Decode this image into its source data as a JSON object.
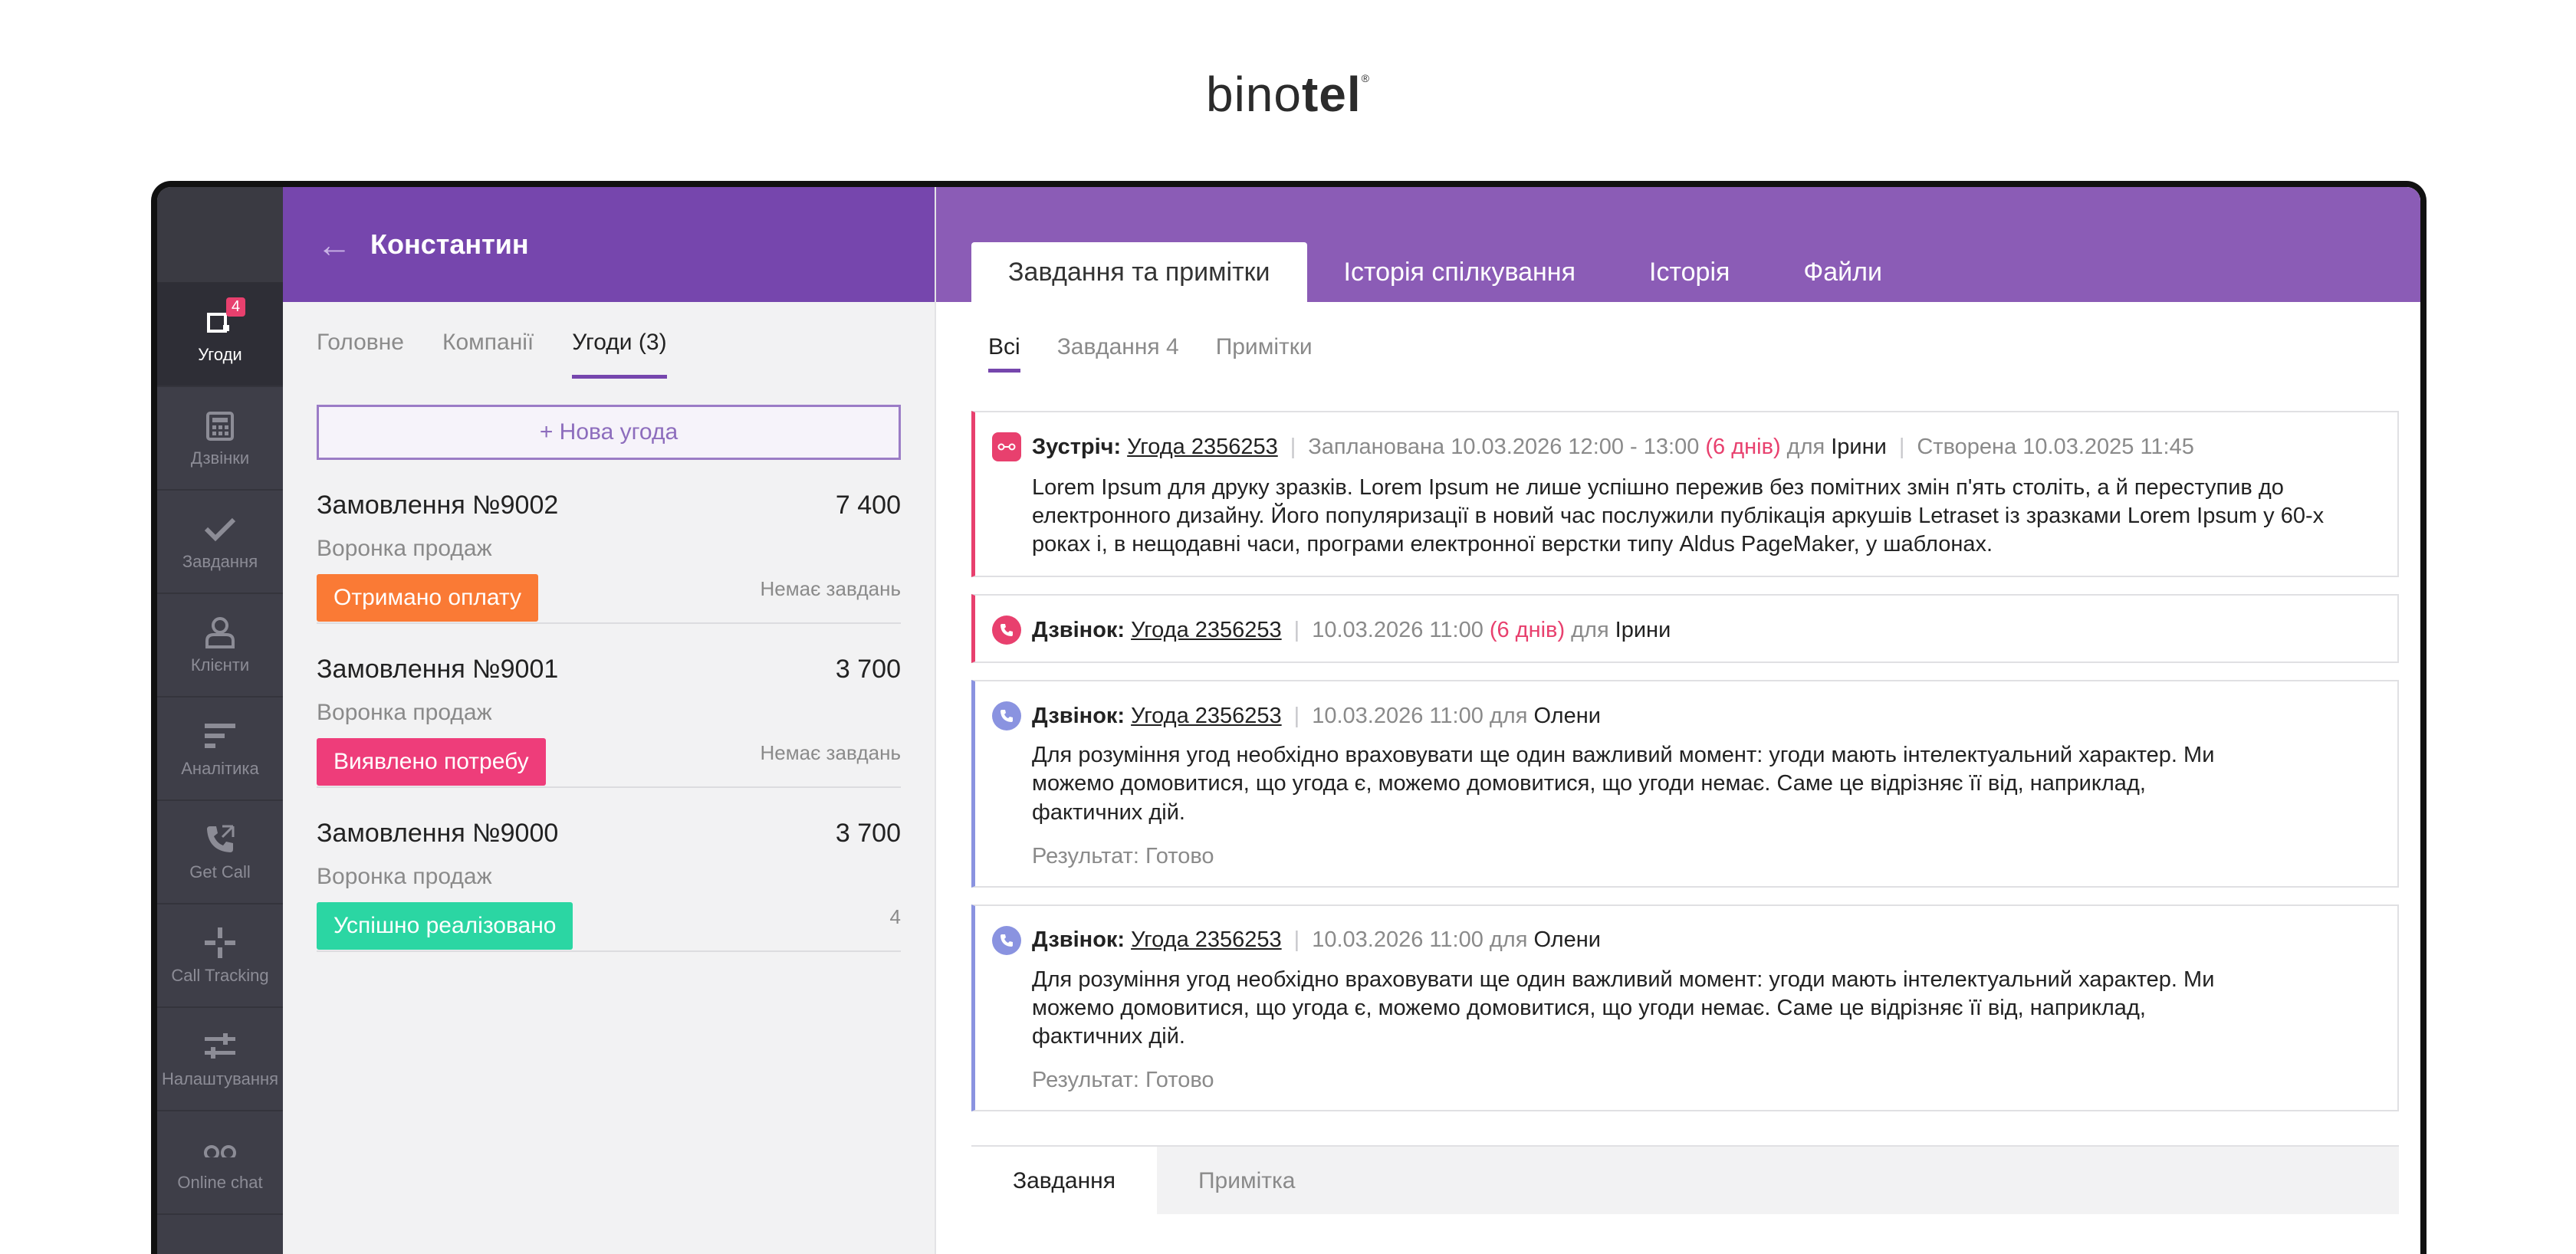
{
  "brand": {
    "pre": "bino",
    "bold": "tel",
    "mark": "®"
  },
  "sidebar": {
    "items": [
      {
        "label": "Угоди",
        "icon": "deals-icon",
        "badge": "4",
        "active": true
      },
      {
        "label": "Дзвінки",
        "icon": "phone-keypad-icon"
      },
      {
        "label": "Завдання",
        "icon": "checkmark-icon"
      },
      {
        "label": "Клієнти",
        "icon": "user-icon"
      },
      {
        "label": "Аналітика",
        "icon": "analytics-icon"
      },
      {
        "label": "Get Call",
        "icon": "callback-icon"
      },
      {
        "label": "Call Tracking",
        "icon": "crosshair-icon"
      },
      {
        "label": "Налаштування",
        "icon": "settings-sliders-icon"
      },
      {
        "label": "Online chat",
        "icon": "chat-icon"
      }
    ]
  },
  "contact": {
    "name": "Константин"
  },
  "left_tabs": [
    "Головне",
    "Компанії",
    "Угоди (3)"
  ],
  "new_deal": "+ Нова угода",
  "deals": [
    {
      "title": "Замовлення №9002",
      "amount": "7 400",
      "funnel": "Воронка продаж",
      "stage": "Отримано оплату",
      "stage_color": "#fa7a35",
      "note": "Немає завдань"
    },
    {
      "title": "Замовлення №9001",
      "amount": "3 700",
      "funnel": "Воронка продаж",
      "stage": "Виявлено потребу",
      "stage_color": "#ee3d7a",
      "note": "Немає завдань"
    },
    {
      "title": "Замовлення №9000",
      "amount": "3 700",
      "funnel": "Воронка продаж",
      "stage": "Успішно реалізовано",
      "stage_color": "#2bd6a3",
      "note": "4"
    }
  ],
  "right_tabs": [
    "Завдання та примітки",
    "Історія спілкування",
    "Історія",
    "Файли"
  ],
  "sub_tabs": [
    "Всі",
    "Завдання 4",
    "Примітки"
  ],
  "feed": [
    {
      "type": "Зустріч:",
      "deal": "Угода 2356253",
      "planned": "Запланована 10.03.2026 12:00 - 13:00",
      "days": "(6 днів)",
      "for": "для",
      "who": "Ірини",
      "created": "Створена 10.03.2025 11:45",
      "body": "Lorem Ipsum для друку зразків. Lorem Ipsum не лише успішно пережив без помітних змін п'ять століть, а й переступив до електронного дизайну. Його популяризації в новий час послужили публікація аркушів Letraset із зразками Lorem Ipsum у 60-х роках і, в нещодавні часи, програми електронної верстки типу Aldus PageMaker, у шаблонах."
    },
    {
      "type": "Дзвінок:",
      "deal": "Угода 2356253",
      "time": "10.03.2026 11:00",
      "days": "(6 днів)",
      "for": "для",
      "who": "Ірини"
    },
    {
      "type": "Дзвінок:",
      "deal": "Угода 2356253",
      "time": "10.03.2026 11:00 для",
      "who": "Олени",
      "body": "Для розуміння угод необхідно враховувати ще один важливий момент: угоди мають інтелектуальний характер. Ми можемо домовитися, що угода є, можемо домовитися, що угоди немає. Саме це відрізняє її від, наприклад, фактичних дій.",
      "result": "Результат: Готово"
    },
    {
      "type": "Дзвінок:",
      "deal": "Угода 2356253",
      "time": "10.03.2026 11:00 для",
      "who": "Олени",
      "body": "Для розуміння угод необхідно враховувати ще один важливий момент: угоди мають інтелектуальний характер. Ми можемо домовитися, що угода є, можемо домовитися, що угоди немає. Саме це відрізняє її від, наприклад, фактичних дій.",
      "result": "Результат: Готово"
    }
  ],
  "bottom_tabs": [
    "Завдання",
    "Примітка"
  ]
}
